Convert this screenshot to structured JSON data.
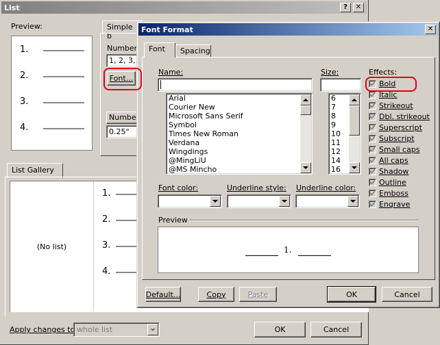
{
  "list_dialog": {
    "title": "List",
    "help_btn": "?",
    "close_btn": "✕",
    "preview_label": "Preview:",
    "preview_numbers": [
      "1.",
      "2.",
      "3.",
      "4."
    ],
    "tab_simple": "Simple b",
    "number_style_label": "Number s",
    "number_style_value": "1, 2, 3,...",
    "font_button": "Font...",
    "number_label2": "Number",
    "indent_value": "0.25\"",
    "gallery_tab": "List Gallery",
    "no_list": "(No list)",
    "gallery_numbers": [
      "1.",
      "2.",
      "3.",
      "4."
    ],
    "apply_label": "Apply changes to:",
    "apply_value": "whole list",
    "ok": "OK",
    "cancel": "Cancel"
  },
  "font_dialog": {
    "title": "Font Format",
    "close_btn": "✕",
    "tabs": {
      "font": "Font",
      "spacing": "Spacing"
    },
    "name_label": "Name:",
    "name_value": "",
    "size_label": "Size:",
    "size_value": "",
    "fonts": [
      "Arial",
      "Courier New",
      "Microsoft Sans Serif",
      "Symbol",
      "Times New Roman",
      "Verdana",
      "Wingdings",
      "@MingLiU",
      "@MS Mincho"
    ],
    "sizes": [
      "6",
      "7",
      "8",
      "9",
      "10",
      "11",
      "12",
      "14",
      "16"
    ],
    "effects_label": "Effects:",
    "effects": [
      {
        "label": "Bold",
        "checked": true
      },
      {
        "label": "Italic",
        "checked": true
      },
      {
        "label": "Strikeout",
        "checked": true
      },
      {
        "label": "Dbl. strikeout",
        "checked": true
      },
      {
        "label": "Superscript",
        "checked": true
      },
      {
        "label": "Subscript",
        "checked": true
      },
      {
        "label": "Small caps",
        "checked": true
      },
      {
        "label": "All caps",
        "checked": true
      },
      {
        "label": "Shadow",
        "checked": true
      },
      {
        "label": "Outline",
        "checked": true
      },
      {
        "label": "Emboss",
        "checked": true
      },
      {
        "label": "Engrave",
        "checked": true
      }
    ],
    "font_color_label": "Font color:",
    "underline_style_label": "Underline style:",
    "underline_color_label": "Underline color:",
    "preview_label": "Preview",
    "preview_number": "1.",
    "default_btn": "Default...",
    "copy_btn": "Copy",
    "paste_btn": "Paste",
    "ok_btn": "OK",
    "cancel_btn": "Cancel"
  },
  "colors": {
    "titlebar_active": "#0a246a",
    "titlebar_active_end": "#a6caf0",
    "titlebar_inactive": "#808080",
    "highlight": "#e0001a"
  }
}
